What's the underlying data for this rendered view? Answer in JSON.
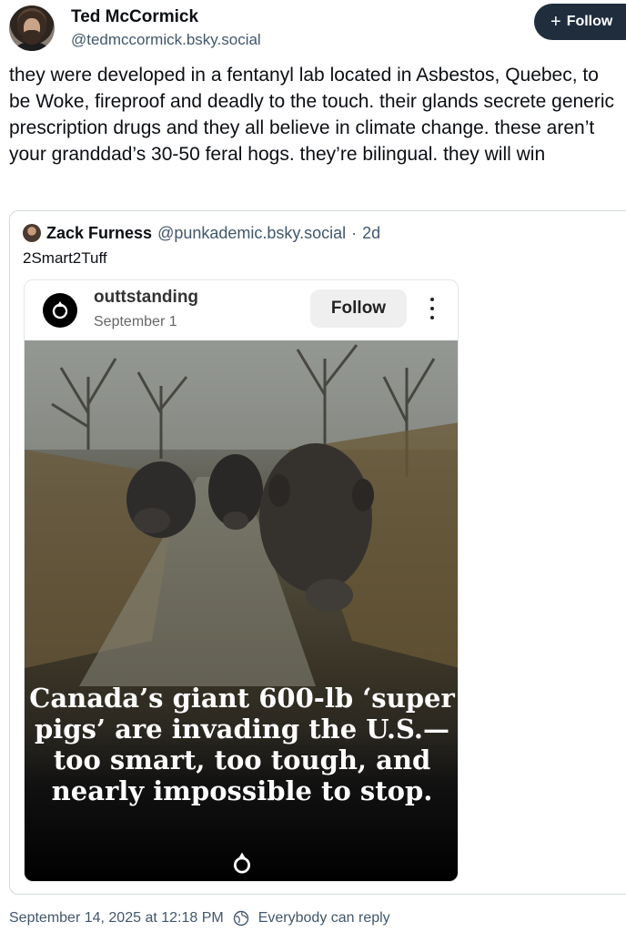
{
  "author": {
    "name": "Ted McCormick",
    "handle": "@tedmccormick.bsky.social"
  },
  "follow_button": {
    "label": "Follow",
    "icon": "plus-icon"
  },
  "post": {
    "text": "they were developed in a fentanyl lab located in Asbestos, Quebec, to be Woke, fireproof and deadly to the touch. their glands secrete generic prescription drugs and they all believe in climate change. these aren’t your granddad’s 30-50 feral hogs. they’re bilingual. they will win"
  },
  "quote": {
    "name": "Zack Furness",
    "handle": "@punkademic.bsky.social",
    "separator": "·",
    "age": "2d",
    "text": "2Smart2Tuff",
    "embed": {
      "username": "outtstanding",
      "date": "September 1",
      "follow_label": "Follow",
      "more_icon": "more-vertical-icon",
      "caption": "Canada’s giant 600-lb ‘super pigs’ are invading the U.S.—too smart, too tough, and nearly impossible to stop."
    }
  },
  "footer": {
    "timestamp": "September 14, 2025 at 12:18 PM",
    "reply_setting": "Everybody can reply",
    "reply_icon": "earth-icon"
  },
  "colors": {
    "follow_bg": "#1f2d3d",
    "muted_text": "#42576c",
    "border": "#d4dbe2"
  }
}
